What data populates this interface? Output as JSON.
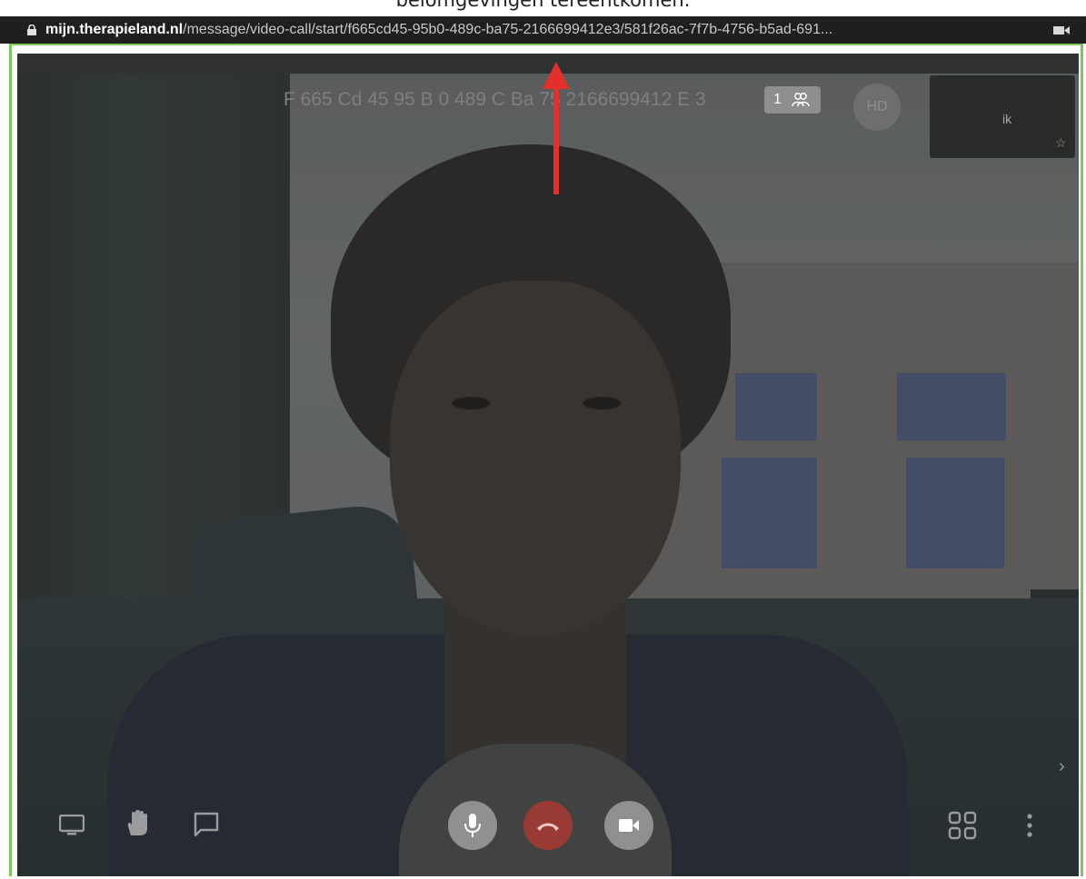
{
  "caption": {
    "text": "belomgevingen tereentkomen."
  },
  "browser": {
    "url_domain": "mijn.therapieland.nl",
    "url_path": "/message/video-call/start/f665cd45-95b0-489c-ba75-2166699412e3/581f26ac-7f7b-4756-b5ad-691..."
  },
  "call": {
    "room_title": "F 665 Cd 45 95 B 0 489 C Ba 75 2166699412 E 3",
    "participant_count": "1",
    "avatar_initials": "HD",
    "self_view_label": "ik"
  },
  "toolbar": {
    "left": [
      "screen-share",
      "raise-hand",
      "chat"
    ],
    "center": [
      "microphone",
      "hang-up",
      "camera"
    ],
    "right": [
      "tile-view",
      "more-options"
    ]
  },
  "colors": {
    "hangup": "#b0403a",
    "arrow": "#e4302a",
    "frame_border": "#7cc85c"
  }
}
